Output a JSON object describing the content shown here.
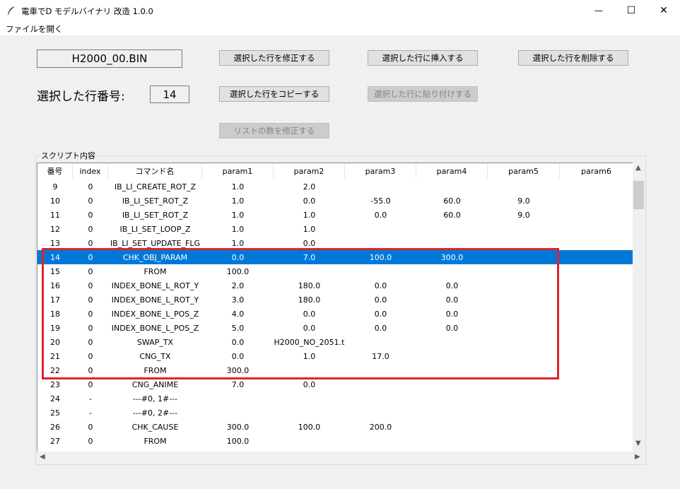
{
  "window": {
    "title": "電車でD モデルバイナリ 改造 1.0.0",
    "minimize_glyph": "—",
    "maximize_glyph": "☐",
    "close_glyph": "✕"
  },
  "menu": {
    "open_file": "ファイルを開く"
  },
  "file": {
    "name": "H2000_00.BIN"
  },
  "selected_row": {
    "label": "選択した行番号:",
    "value": "14"
  },
  "buttons": {
    "modify_row": "選択した行を修正する",
    "insert_row": "選択した行に挿入する",
    "delete_row": "選択した行を削除する",
    "copy_row": "選択した行をコピーする",
    "paste_row": "選択した行に貼り付けする",
    "modify_list_count": "リストの数を修正する"
  },
  "script": {
    "group_label": "スクリプト内容",
    "columns": [
      "番号",
      "index",
      "コマンド名",
      "param1",
      "param2",
      "param3",
      "param4",
      "param5",
      "param6"
    ],
    "selected_index": 5,
    "rows": [
      [
        "9",
        "0",
        "IB_LI_CREATE_ROT_Z",
        "1.0",
        "2.0",
        "",
        "",
        "",
        ""
      ],
      [
        "10",
        "0",
        "IB_LI_SET_ROT_Z",
        "1.0",
        "0.0",
        "-55.0",
        "60.0",
        "9.0",
        ""
      ],
      [
        "11",
        "0",
        "IB_LI_SET_ROT_Z",
        "1.0",
        "1.0",
        "0.0",
        "60.0",
        "9.0",
        ""
      ],
      [
        "12",
        "0",
        "IB_LI_SET_LOOP_Z",
        "1.0",
        "1.0",
        "",
        "",
        "",
        ""
      ],
      [
        "13",
        "0",
        "IB_LI_SET_UPDATE_FLG",
        "1.0",
        "0.0",
        "",
        "",
        "",
        ""
      ],
      [
        "14",
        "0",
        "CHK_OBJ_PARAM",
        "0.0",
        "7.0",
        "100.0",
        "300.0",
        "",
        ""
      ],
      [
        "15",
        "0",
        "FROM",
        "100.0",
        "",
        "",
        "",
        "",
        ""
      ],
      [
        "16",
        "0",
        "INDEX_BONE_L_ROT_Y",
        "2.0",
        "180.0",
        "0.0",
        "0.0",
        "",
        ""
      ],
      [
        "17",
        "0",
        "INDEX_BONE_L_ROT_Y",
        "3.0",
        "180.0",
        "0.0",
        "0.0",
        "",
        ""
      ],
      [
        "18",
        "0",
        "INDEX_BONE_L_POS_Z",
        "4.0",
        "0.0",
        "0.0",
        "0.0",
        "",
        ""
      ],
      [
        "19",
        "0",
        "INDEX_BONE_L_POS_Z",
        "5.0",
        "0.0",
        "0.0",
        "0.0",
        "",
        ""
      ],
      [
        "20",
        "0",
        "SWAP_TX",
        "0.0",
        "H2000_NO_2051.t",
        "",
        "",
        "",
        ""
      ],
      [
        "21",
        "0",
        "CNG_TX",
        "0.0",
        "1.0",
        "17.0",
        "",
        "",
        ""
      ],
      [
        "22",
        "0",
        "FROM",
        "300.0",
        "",
        "",
        "",
        "",
        ""
      ],
      [
        "23",
        "0",
        "CNG_ANIME",
        "7.0",
        "0.0",
        "",
        "",
        "",
        ""
      ],
      [
        "24",
        "-",
        "---#0, 1#---",
        "",
        "",
        "",
        "",
        "",
        ""
      ],
      [
        "25",
        "-",
        "---#0, 2#---",
        "",
        "",
        "",
        "",
        "",
        ""
      ],
      [
        "26",
        "0",
        "CHK_CAUSE",
        "300.0",
        "100.0",
        "200.0",
        "",
        "",
        ""
      ],
      [
        "27",
        "0",
        "FROM",
        "100.0",
        "",
        "",
        "",
        "",
        ""
      ]
    ]
  },
  "colors": {
    "selection": "#0078d7",
    "highlight_box": "#e0232b"
  }
}
